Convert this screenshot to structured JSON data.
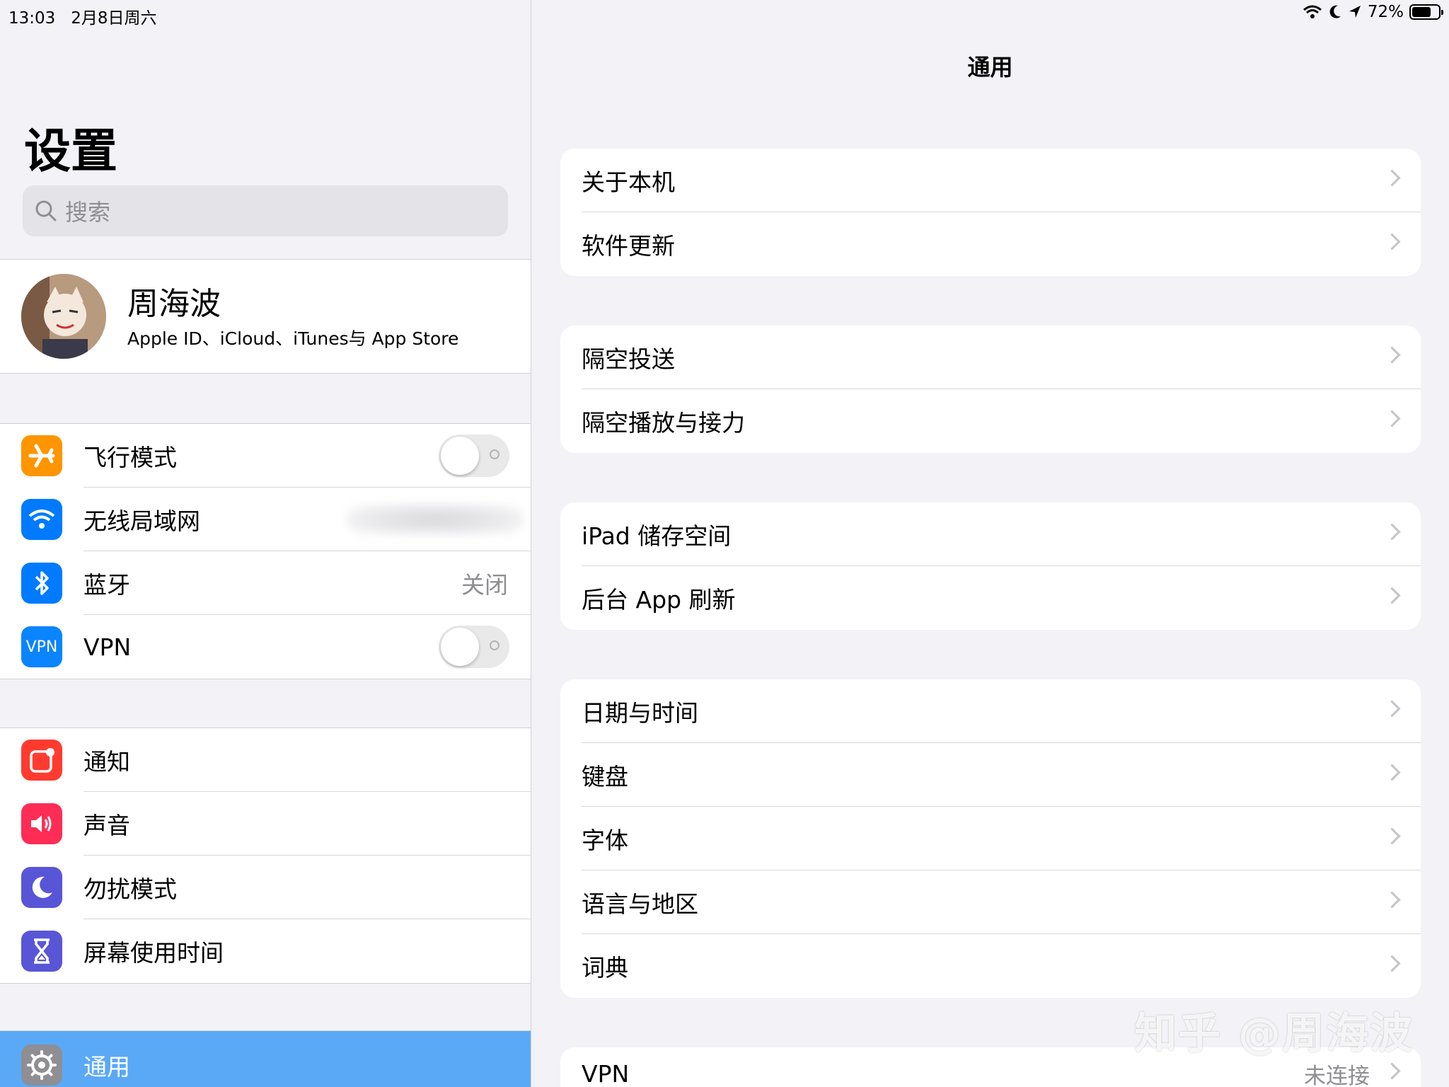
{
  "status": {
    "time": "13:03",
    "date": "2月8日周六",
    "battery": "72%"
  },
  "sidebar": {
    "title": "设置",
    "search_placeholder": "搜索",
    "profile": {
      "name": "周海波",
      "subtitle": "Apple ID、iCloud、iTunes与 App Store"
    },
    "group1": [
      {
        "label": "飞行模式",
        "icon": "airplane-icon",
        "color": "#ff9500",
        "type": "toggle"
      },
      {
        "label": "无线局域网",
        "icon": "wifi-icon",
        "color": "#007aff",
        "type": "blurred"
      },
      {
        "label": "蓝牙",
        "icon": "bluetooth-icon",
        "color": "#007aff",
        "value": "关闭"
      },
      {
        "label": "VPN",
        "icon": "vpn-icon",
        "color": "#0a84ff",
        "type": "toggle",
        "icon_text": "VPN"
      }
    ],
    "group2": [
      {
        "label": "通知",
        "icon": "notifications-icon",
        "color": "#ff3b30"
      },
      {
        "label": "声音",
        "icon": "sound-icon",
        "color": "#ff2d55"
      },
      {
        "label": "勿扰模式",
        "icon": "moon-icon",
        "color": "#5856d6"
      },
      {
        "label": "屏幕使用时间",
        "icon": "hourglass-icon",
        "color": "#5856d6"
      }
    ],
    "group3": [
      {
        "label": "通用",
        "icon": "gear-icon",
        "color": "#8e8e93",
        "selected": true
      }
    ]
  },
  "detail": {
    "title": "通用",
    "groups": [
      [
        "关于本机",
        "软件更新"
      ],
      [
        "隔空投送",
        "隔空播放与接力"
      ],
      [
        "iPad 储存空间",
        "后台 App 刷新"
      ],
      [
        "日期与时间",
        "键盘",
        "字体",
        "语言与地区",
        "词典"
      ]
    ],
    "vpn_row": {
      "label": "VPN",
      "value": "未连接"
    }
  },
  "watermark": "知乎 @周海波"
}
